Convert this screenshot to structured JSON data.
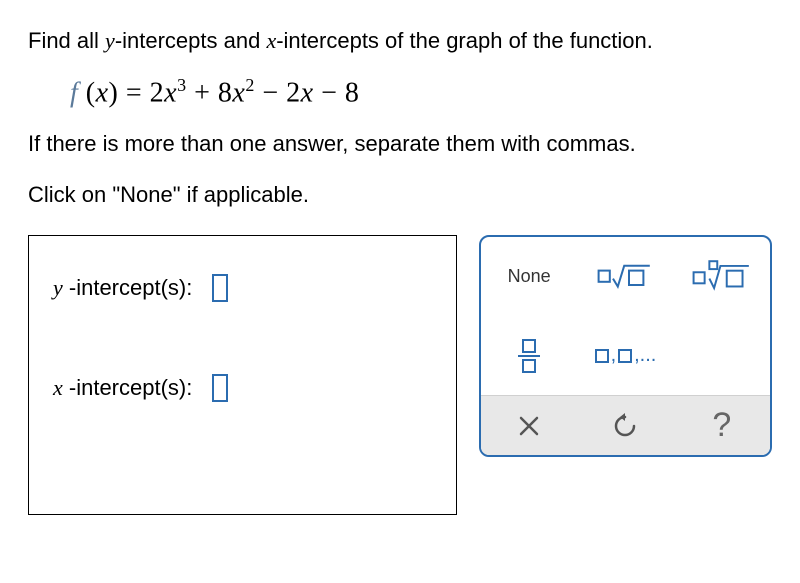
{
  "question": {
    "part1": "Find all ",
    "var1": "y",
    "part2": "-intercepts and ",
    "var2": "x",
    "part3": "-intercepts of the graph of the function."
  },
  "equation": {
    "full": "f(x) = 2x³ + 8x² − 2x − 8"
  },
  "instruction1": "If there is more than one answer, separate them with commas.",
  "instruction2": "Click on \"None\" if applicable.",
  "answers": {
    "y_intercept_label_var": "y",
    "y_intercept_label_text": " -intercept(s):",
    "x_intercept_label_var": "x",
    "x_intercept_label_text": " -intercept(s):"
  },
  "tools": {
    "none": "None",
    "list": ",...",
    "close": "×",
    "reset": "↺",
    "help": "?"
  }
}
